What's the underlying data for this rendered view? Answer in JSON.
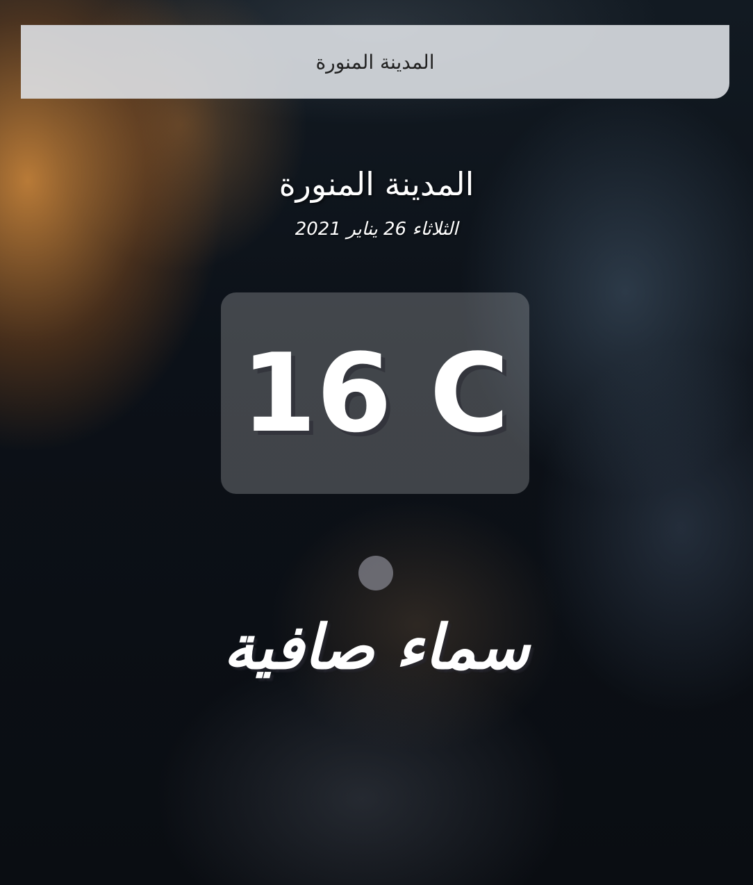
{
  "search": {
    "value": "المدينة المنورة",
    "placeholder": ""
  },
  "weather": {
    "location": "المدينة المنورة",
    "date": "الثلاثاء 26 يناير 2021",
    "temperature": "16 C",
    "condition": "سماء صافية",
    "icon": "weather-icon"
  }
}
